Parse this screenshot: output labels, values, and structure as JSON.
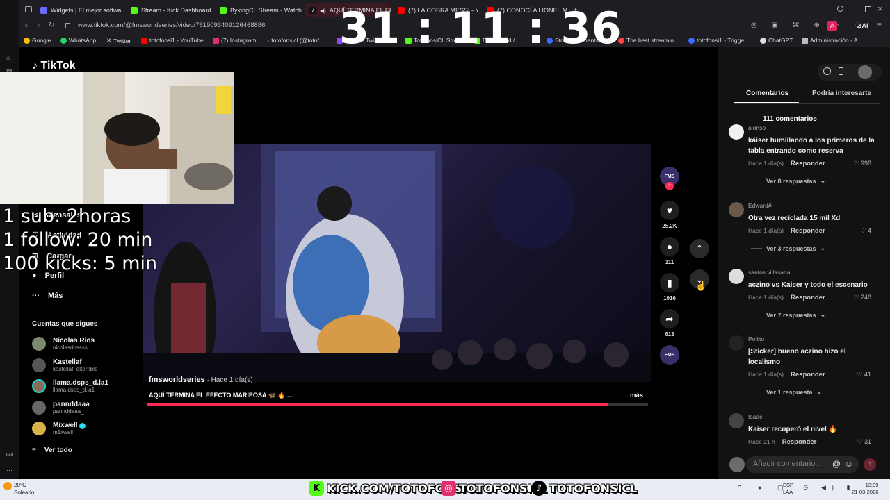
{
  "browser": {
    "tabs": [
      {
        "label": "Widgets | El mejor softwar",
        "color": "#6b6bff"
      },
      {
        "label": "Stream - Kick Dashboard",
        "color": "#53fc18"
      },
      {
        "label": "BykingCL Stream - Watch",
        "color": "#53fc18"
      },
      {
        "label": "AQUÍ TERMINA EL EF",
        "color": "#ffffff"
      },
      {
        "label": "(7) LA COBRA MESSI - Yo",
        "color": "#ff0000"
      },
      {
        "label": "(7) CONOCÍ A LIONEL ME",
        "color": "#ff0000"
      }
    ],
    "url": "www.tiktok.com/@fmsworldseries/video/7619093409126468886",
    "bookmarks": [
      {
        "label": "Google",
        "color": "#fbbc05"
      },
      {
        "label": "WhatsApp",
        "color": "#25d366"
      },
      {
        "label": "Twitter",
        "color": "#ffffff"
      },
      {
        "label": "totofonsi1 - YouTube",
        "color": "#ff0000"
      },
      {
        "label": "(7) Instagram",
        "color": "#e1306c"
      },
      {
        "label": "totofonsicl (@totof...",
        "color": "#ffffff"
      },
      {
        "label": "...nsi1 - Twitch",
        "color": "#9146ff"
      },
      {
        "label": "TotofonsiCL Strea...",
        "color": "#53fc18"
      },
      {
        "label": "Dashboard / ...",
        "color": "#53fc18"
      },
      {
        "label": "StreamElements - ...",
        "color": "#3c6cff"
      },
      {
        "label": "The best streamin...",
        "color": "#ff4444"
      },
      {
        "label": "totofonsi1 - Trigge...",
        "color": "#3c6cff"
      },
      {
        "label": "ChatGPT",
        "color": "#dddddd"
      },
      {
        "label": "Administración - A...",
        "color": "#dddddd"
      }
    ]
  },
  "timer": "31 : 11 : 36",
  "overlay": {
    "lines": [
      "1 sub: 2horas",
      "1 follow: 20 min",
      "100 kicks: 5 min"
    ]
  },
  "tiktok": {
    "logo": "TikTok",
    "nav": [
      {
        "label": "Mensajes",
        "icon": "✉"
      },
      {
        "label": "Actividad",
        "icon": "♡"
      },
      {
        "label": "Cargar",
        "icon": "⊞"
      },
      {
        "label": "Perfil",
        "icon": "●"
      },
      {
        "label": "Más",
        "icon": "···"
      }
    ],
    "following_title": "Cuentas que sigues",
    "following": [
      {
        "name": "Nicolas Rios",
        "handle": "nicolasriossss"
      },
      {
        "name": "Kastellaf",
        "handle": "kastellaf_elterrible"
      },
      {
        "name": "llama.dsps_d.la1",
        "handle": "llama.dsps_d.la1"
      },
      {
        "name": "pannddaaa",
        "handle": "pannddaaa_"
      },
      {
        "name": "Mixwell",
        "handle": "m1xwell"
      }
    ],
    "see_all": "Ver todo",
    "video": {
      "author": "fmsworldseries",
      "time": " · Hace 1 día(s)",
      "caption": "AQUÍ TERMINA EL EFECTO MARIPOSA 🦋 🔥 ...",
      "more": "más",
      "progress": 0.92
    },
    "actions": {
      "likes": "25.2K",
      "comments": "111",
      "saves": "1916",
      "shares": "613"
    }
  },
  "comments_panel": {
    "tabs": [
      "Comentarios",
      "Podría interesarte"
    ],
    "count": "111 comentarios",
    "items": [
      {
        "user": "alonso",
        "text": "káiser humillando a los primeros de la tabla entrando como reserva",
        "time": "Hace 1 día(s)",
        "reply": "Responder",
        "likes": "998",
        "more": "Ver 8 respuestas"
      },
      {
        "user": "Edward#",
        "text": "Otra vez reciclada 15 mil Xd",
        "time": "Hace 1 día(s)",
        "reply": "Responder",
        "likes": "4",
        "more": "Ver 3 respuestas"
      },
      {
        "user": "santos villasana",
        "text": "aczino vs Kaiser y todo el escenario",
        "time": "Hace 1 día(s)",
        "reply": "Responder",
        "likes": "248",
        "more": "Ver 7 respuestas"
      },
      {
        "user": "Pollito",
        "text": "[Sticker] bueno aczino hizo el localismo",
        "time": "Hace 1 día(s)",
        "reply": "Responder",
        "likes": "41",
        "more": "Ver 1 respuesta"
      },
      {
        "user": "Isaac",
        "text": "Kaiser recuperó el nivel 🔥",
        "time": "Hace 21 h",
        "reply": "Responder",
        "likes": "31",
        "more": ""
      }
    ],
    "add_placeholder": "Añadir comentario..."
  },
  "socials": [
    {
      "label": "KICK.COM/TOTOFONSICL",
      "color": "#53fc18",
      "icon": "K"
    },
    {
      "label": "TOTOFONSICL",
      "color": "#e1306c",
      "icon": "◎"
    },
    {
      "label": "TOTOFONSICL",
      "color": "#000000",
      "icon": "♪"
    }
  ],
  "taskbar": {
    "weather_temp": "20°C",
    "weather_desc": "Soleado",
    "lang1": "ESP",
    "lang2": "LAA",
    "time": "13:09",
    "date": "21-03-2026"
  }
}
